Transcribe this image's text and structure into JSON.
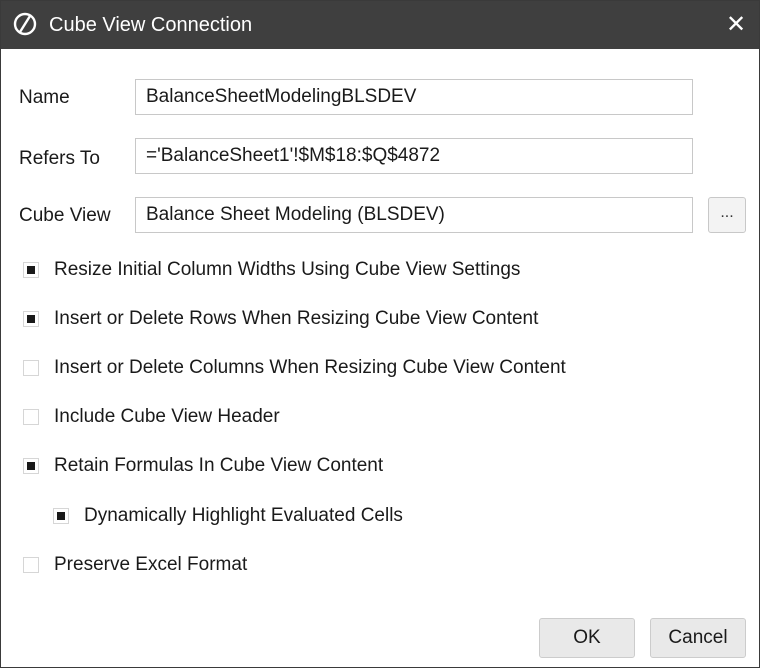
{
  "window": {
    "title": "Cube View Connection",
    "logo_icon": "onestream-logo-icon",
    "close_icon": "close-icon",
    "close_glyph": "✕"
  },
  "fields": {
    "name_label": "Name",
    "name_value": "BalanceSheetModelingBLSDEV",
    "refers_to_label": "Refers To",
    "refers_to_value": "='BalanceSheet1'!$M$18:$Q$4872",
    "cube_view_label": "Cube View",
    "cube_view_value": "Balance Sheet Modeling (BLSDEV)",
    "browse_label": "..."
  },
  "options": [
    {
      "label": "Resize Initial Column Widths Using Cube View Settings",
      "checked": true
    },
    {
      "label": "Insert or Delete Rows When Resizing Cube View Content",
      "checked": true
    },
    {
      "label": "Insert or Delete Columns When Resizing Cube View Content",
      "checked": false
    },
    {
      "label": "Include Cube View Header",
      "checked": false
    },
    {
      "label": "Retain Formulas In Cube View Content",
      "checked": true
    },
    {
      "label": "Dynamically Highlight Evaluated Cells",
      "checked": true
    },
    {
      "label": "Preserve Excel Format",
      "checked": false
    }
  ],
  "buttons": {
    "ok_label": "OK",
    "cancel_label": "Cancel"
  },
  "colors": {
    "titlebar": "#3f3f3f",
    "checkbox_fill": "#1a1a1a",
    "button_bg": "#e9e9e9"
  }
}
